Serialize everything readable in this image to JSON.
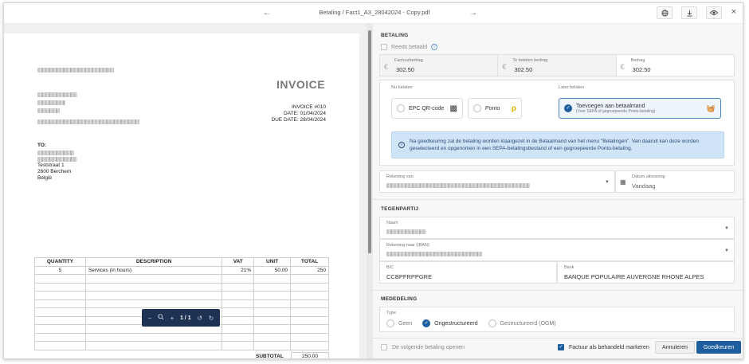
{
  "topbar": {
    "breadcrumb": "Betaling / Fact1_A3_28042024 - Copy.pdf",
    "prev_icon": "arrow-left-icon",
    "next_icon": "arrow-right-icon",
    "actions": [
      "globe-icon",
      "download-icon",
      "eye-icon"
    ],
    "close_label": "×"
  },
  "invoice": {
    "title": "INVOICE",
    "number": "INVOICE #010",
    "date": "DATE: 01/04/2024",
    "due_date": "DUE DATE: 28/04/2024",
    "to_label": "TO:",
    "to_street": "Teststraat 1",
    "to_city": "2600 Berchem",
    "to_country": "België",
    "columns": [
      "QUANTITY",
      "DESCRIPTION",
      "VAT",
      "UNIT",
      "TOTAL"
    ],
    "rows": [
      {
        "quantity": "5",
        "description": "Services (in hours)",
        "vat": "21%",
        "unit": "50.00",
        "total": "250"
      }
    ],
    "subtotal_label": "SUBTOTAL",
    "subtotal_value": "250.00"
  },
  "pager": {
    "page": "1 / 1"
  },
  "betaling": {
    "section_title": "BETALING",
    "reeds_betaald": "Reeds betaald",
    "factuurbedrag_label": "Factuurbedrag",
    "factuurbedrag": "302.50",
    "te_betalen_label": "Te betalen bedrag",
    "te_betalen": "302.50",
    "bedrag_label": "Bedrag",
    "bedrag": "302.50",
    "nu_betalen": "Nu betalen",
    "later_betalen": "Later betalen",
    "opt_qr": "EPC QR-code",
    "opt_ponto": "Ponto",
    "opt_betaalmand": "Toevoegen aan betaalmand",
    "opt_betaalmand_sub": "(Voor SEPA of gegroepeerde Ponto-betaling)",
    "info_text": "Na goedkeuring zal de betaling worden klaargezet in de Betaalmand van het menu \"Betalingen\". Van daaruit kan deze worden geselecteerd en opgenomen in een SEPA-betalingsbestand of een gegroepeerde Ponto-betaling.",
    "rekening_van_label": "Rekening van",
    "datum_label": "Datum uitvoering",
    "datum_value": "Vandaag"
  },
  "tegenpartij": {
    "section_title": "TEGENPARTIJ",
    "naam_label": "Naam",
    "rekening_naar_label": "Rekening naar (IBAN)",
    "bic_label": "BIC",
    "bic_value": "CCBPFRPPGRE",
    "bank_label": "Bank",
    "bank_value": "BANQUE POPULAIRE AUVERGNE RHONE ALPES"
  },
  "mededeling": {
    "section_title": "MEDEDELING",
    "type_label": "Type",
    "options": [
      "Geen",
      "Ongestructureerd",
      "Gestructureerd (OGM)"
    ],
    "selected": "Ongestructureerd"
  },
  "footer": {
    "volgende_openen": "De volgende betaling openen",
    "factuur_behandeld": "Factuur als behandeld markeren",
    "annuleren": "Annuleren",
    "goedkeuren": "Goedkeuren"
  },
  "colors": {
    "primary": "#1d5e9e",
    "info_bg": "#cfe4f7",
    "pager_bg": "#1e3353"
  }
}
